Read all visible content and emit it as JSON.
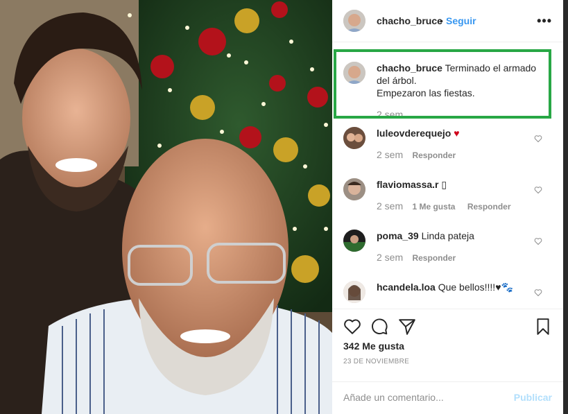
{
  "post": {
    "username": "chacho_bruce",
    "separator": "•",
    "follow_label": "Seguir",
    "more_label": "•••"
  },
  "caption": {
    "username": "chacho_bruce",
    "text_line1": "Terminado el armado del árbol.",
    "text_line2": "Empezaron las fiestas.",
    "time": "2 sem"
  },
  "comments": [
    {
      "username": "luleovderequejo",
      "text": "♥",
      "time": "2 sem",
      "likes": "",
      "reply": "Responder"
    },
    {
      "username": "flaviomassa.r",
      "text": "▯",
      "time": "2 sem",
      "likes": "1 Me gusta",
      "reply": "Responder"
    },
    {
      "username": "poma_39",
      "text": "Linda pateja",
      "time": "2 sem",
      "likes": "",
      "reply": "Responder"
    },
    {
      "username": "hcandela.loa",
      "text": "Que bellos!!!!♥🐾",
      "time": "",
      "likes": "",
      "reply": ""
    }
  ],
  "engagement": {
    "likes_text": "342 Me gusta",
    "date_text": "23 DE NOVIEMBRE"
  },
  "add_comment": {
    "placeholder": "Añade un comentario...",
    "publish_label": "Publicar"
  },
  "colors": {
    "accent": "#3897f0",
    "highlight_border": "#28a745",
    "publish_disabled": "#b2dffc"
  }
}
